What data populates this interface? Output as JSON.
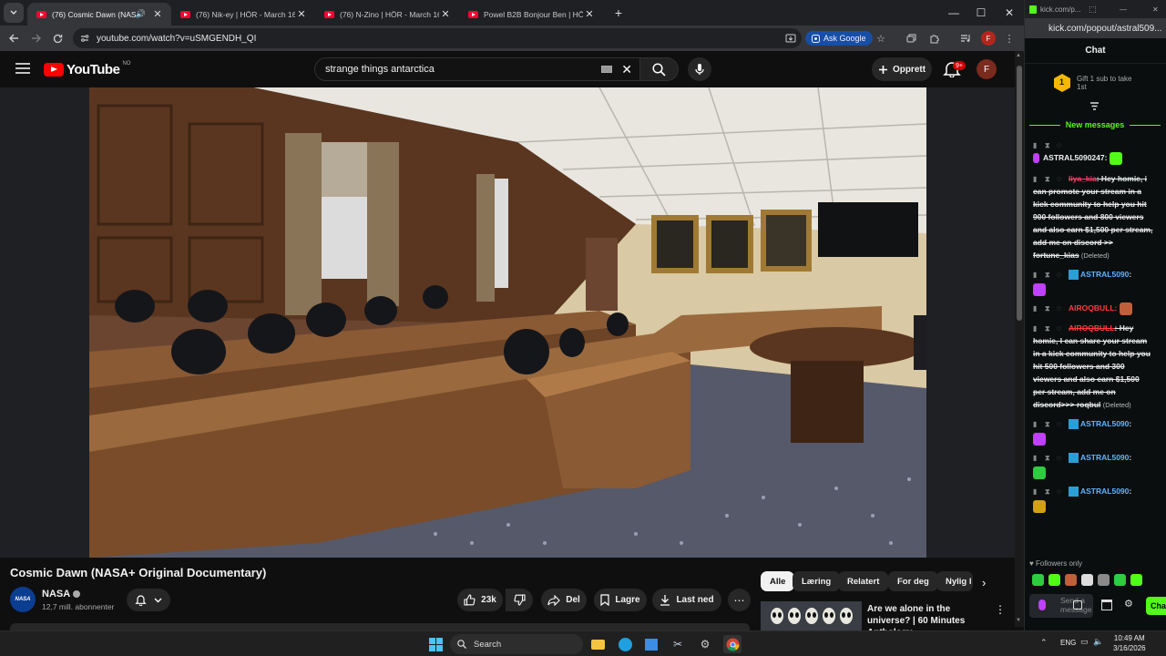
{
  "browser": {
    "tabs": [
      {
        "title": "(76) Cosmic Dawn (NASA+",
        "active": true,
        "audio": true
      },
      {
        "title": "(76) Nik-ey | HÖR - March 16 /",
        "active": false
      },
      {
        "title": "(76) N-Zino | HÖR - March 16 /",
        "active": false
      },
      {
        "title": "Powel B2B Bonjour Ben | HÖR",
        "active": false
      }
    ],
    "url": "youtube.com/watch?v=uSMGENDH_QI",
    "ask_google": "Ask Google",
    "profile_initial": "F"
  },
  "youtube": {
    "logo_text": "YouTube",
    "country": "NO",
    "search_query": "strange things antarctica",
    "create_label": "Opprett",
    "notif_count": "9+",
    "avatar_initial": "F",
    "video_title": "Cosmic Dawn (NASA+ Original Documentary)",
    "channel": {
      "name": "NASA",
      "subscribers": "12,7 mill. abonnenter",
      "avatar_text": "NASA"
    },
    "actions": {
      "likes": "23k",
      "share": "Del",
      "save": "Lagre",
      "download": "Last ned"
    },
    "chips": [
      "Alle",
      "Læring",
      "Relatert",
      "For deg",
      "Nylig l"
    ],
    "related": {
      "title": "Are we alone in the universe? | 60 Minutes Anthology"
    }
  },
  "kick": {
    "tab_url": "kick.com/p...",
    "url": "kick.com/popout/astral509...",
    "header": "Chat",
    "gift_count": "1",
    "gift_text": "Gift 1 sub to take 1st",
    "new_messages": "New messages",
    "messages": [
      {
        "user": "ASTRAL5090247:",
        "user_color": "#f1f1f1",
        "text": "",
        "emote": "#53fc18"
      },
      {
        "user": "liya_kia",
        "user_color": "#ff3b6b",
        "text": ": Hey homie, i can promote your stream in a kick community to help you hit 900 followers and 800 viewers and also earn $1,500 per stream, add me on discord >> fortune_kias",
        "deleted": "(Deleted)"
      },
      {
        "user": "ASTRAL5090",
        "user_color": "#5fb4ff",
        "text": ":",
        "emote": "#c040ff"
      },
      {
        "user": "AIROQBULL:",
        "user_color": "#ff3b3b",
        "text": "",
        "emote": "#c0603a"
      },
      {
        "user": "AIROQBULL",
        "user_color": "#ff3b3b",
        "text": ": Hey homie, I can share your stream in a kick community to help you hit 500 followers and 300 viewers and also earn $1,500 per stream, add me on discord>>> roqbul",
        "deleted": "(Deleted)"
      },
      {
        "user": "ASTRAL5090",
        "user_color": "#5fb4ff",
        "text": ":",
        "emote": "#c040ff"
      },
      {
        "user": "ASTRAL5090",
        "user_color": "#5fb4ff",
        "text": ":",
        "emote": "#2ecc40"
      },
      {
        "user": "ASTRAL5090",
        "user_color": "#5fb4ff",
        "text": ":",
        "emote": "#d4a017"
      }
    ],
    "followers_only": "Followers only",
    "input_placeholder": "Send a message",
    "send_label": "Cha"
  },
  "taskbar": {
    "search": "Search",
    "lang": "ENG",
    "time": "10:49 AM",
    "date": "3/16/2026"
  }
}
